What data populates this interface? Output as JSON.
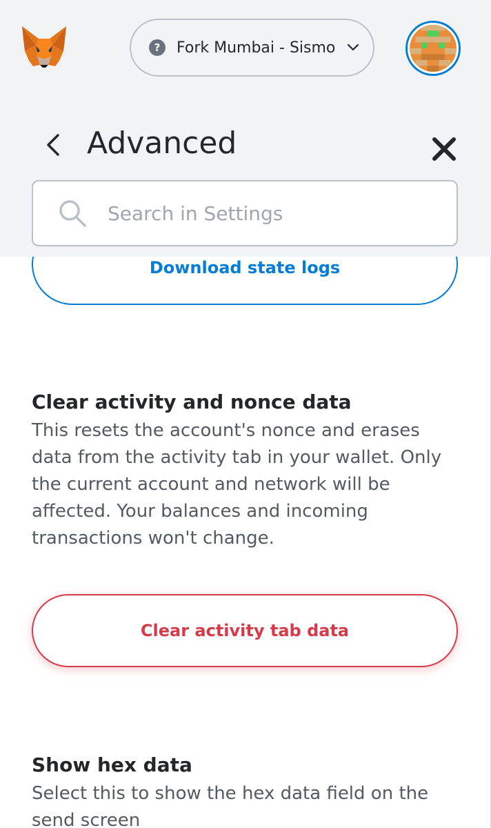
{
  "header": {
    "network_label": "Fork Mumbai - Sismo",
    "network_icon": "question-mark-icon",
    "logo": "metamask-fox-logo",
    "avatar": "account-identicon"
  },
  "settings": {
    "title": "Advanced",
    "back_icon": "chevron-left-icon",
    "close_icon": "close-icon",
    "search_placeholder": "Search in Settings"
  },
  "content": {
    "download_logs_button": "Download state logs",
    "clear_activity": {
      "title": "Clear activity and nonce data",
      "description": "This resets the account's nonce and erases data from the activity tab in your wallet. Only the current account and network will be affected. Your balances and incoming transactions won't change.",
      "button": "Clear activity tab data"
    },
    "show_hex": {
      "title": "Show hex data",
      "description": "Select this to show the hex data field on the send screen"
    }
  },
  "colors": {
    "primary": "#037dd6",
    "error": "#d73a49",
    "background": "#f2f3f4",
    "text_default": "#24272a",
    "text_muted": "#535a61"
  }
}
